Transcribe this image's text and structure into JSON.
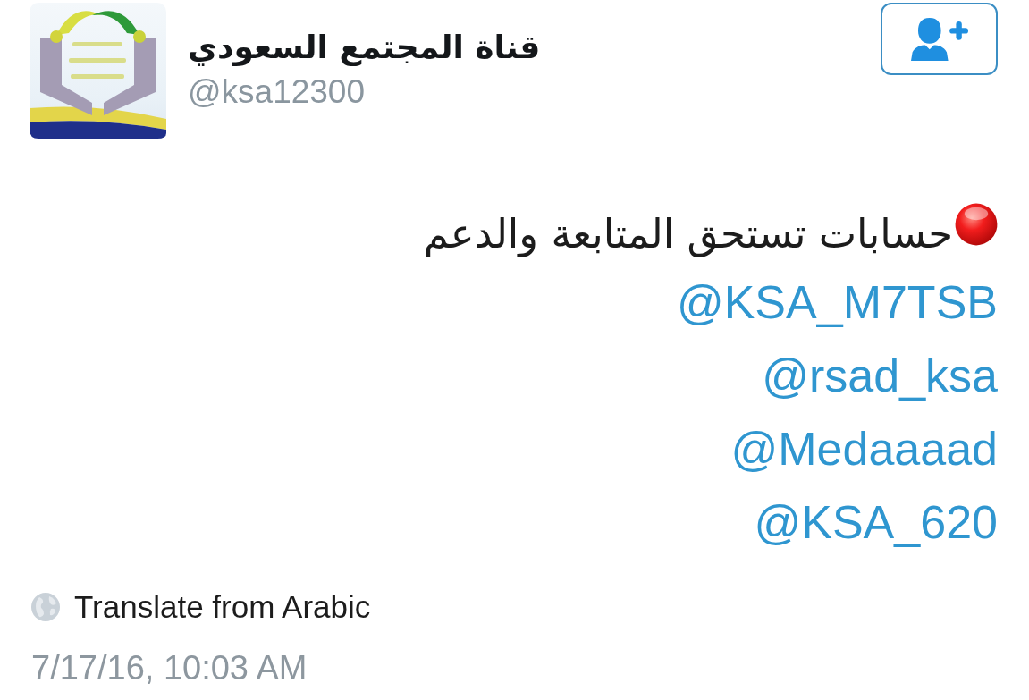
{
  "profile": {
    "display_name": "قناة المجتمع السعودي",
    "handle": "@ksa12300"
  },
  "tweet": {
    "text": "حسابات تستحق المتابعة والدعم",
    "mentions": [
      "@KSA_M7TSB",
      "@rsad_ksa",
      "@Medaaaad",
      "@KSA_620"
    ]
  },
  "translate_link": "Translate from Arabic",
  "timestamp": "7/17/16, 10:03 AM"
}
